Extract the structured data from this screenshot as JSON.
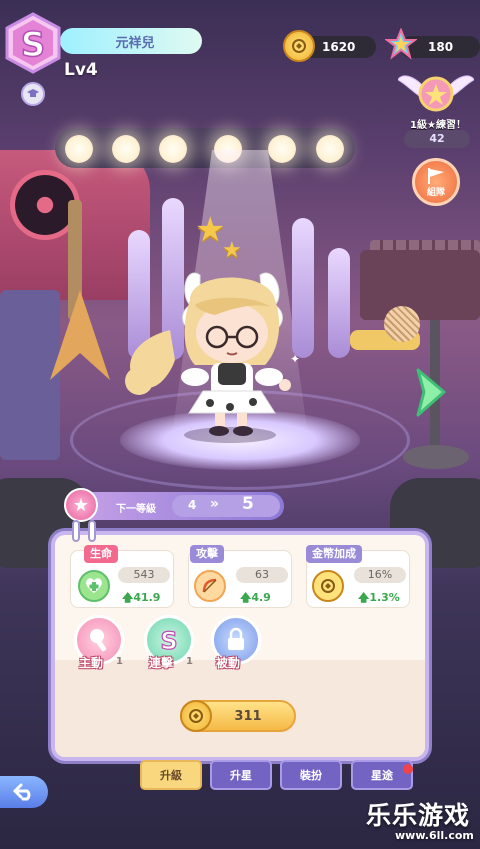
{
  "player": {
    "name": "元祥兒",
    "level": "Lv4",
    "badge_letter": "S"
  },
  "currency": {
    "coins": "1620",
    "stars": "180"
  },
  "rank": {
    "label": "1級★練習！",
    "count": "42"
  },
  "team_button": {
    "label": "組隊"
  },
  "level_strip": {
    "label": "下一等級",
    "from": "4",
    "arrows": "»",
    "to": "5"
  },
  "stats": [
    {
      "title": "生命",
      "value": "543",
      "increase": "41.9",
      "color": "#f26b8f",
      "icon": "heart-plus-icon"
    },
    {
      "title": "攻擊",
      "value": "63",
      "increase": "4.9",
      "color": "#f2a552",
      "icon": "bow-icon"
    },
    {
      "title": "金幣加成",
      "value": "16%",
      "increase": "1.3%",
      "color": "#f2a552",
      "icon": "coin-plus-icon"
    }
  ],
  "skills": [
    {
      "label": "主動",
      "level": "1",
      "icon": "microphone-icon"
    },
    {
      "label": "連擊",
      "level": "1",
      "icon": "s-swirl-icon"
    },
    {
      "label": "被動",
      "level": "",
      "icon": "lock-icon"
    }
  ],
  "upgrade": {
    "cost": "311"
  },
  "tabs": [
    {
      "label": "升級",
      "active": true
    },
    {
      "label": "升星",
      "active": false
    },
    {
      "label": "裝扮",
      "active": false
    },
    {
      "label": "星途",
      "active": false
    }
  ],
  "watermark": {
    "main": "乐乐游戏",
    "url": "www.6ll.com"
  },
  "colors": {
    "accent": "#8b79d7",
    "panel": "#fdf6ee",
    "increase": "#3aa84f",
    "upgrade": "#f5b947"
  }
}
